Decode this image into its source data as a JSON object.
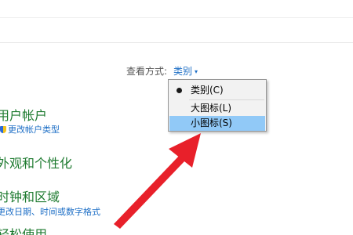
{
  "view_by": {
    "label": "查看方式:",
    "value": "类别",
    "caret": "▾"
  },
  "menu": {
    "items": [
      {
        "label": "类别(C)",
        "selected": true
      },
      {
        "label": "大图标(L)",
        "selected": false
      },
      {
        "label": "小图标(S)",
        "selected": false,
        "highlighted": true
      }
    ]
  },
  "categories": [
    {
      "title": "用户帐户",
      "link": "更改帐户类型"
    },
    {
      "title": "外观和个性化"
    },
    {
      "title": "时钟和区域",
      "link": "更改日期、时间或数字格式"
    },
    {
      "title": "轻松使用"
    }
  ],
  "colors": {
    "category_title": "#1d7a2f",
    "link": "#1e6fc6",
    "menu_highlight": "#91c9f7",
    "arrow": "#e8202a"
  },
  "icons": {
    "account_link_icon": "uac-shield-icon"
  }
}
